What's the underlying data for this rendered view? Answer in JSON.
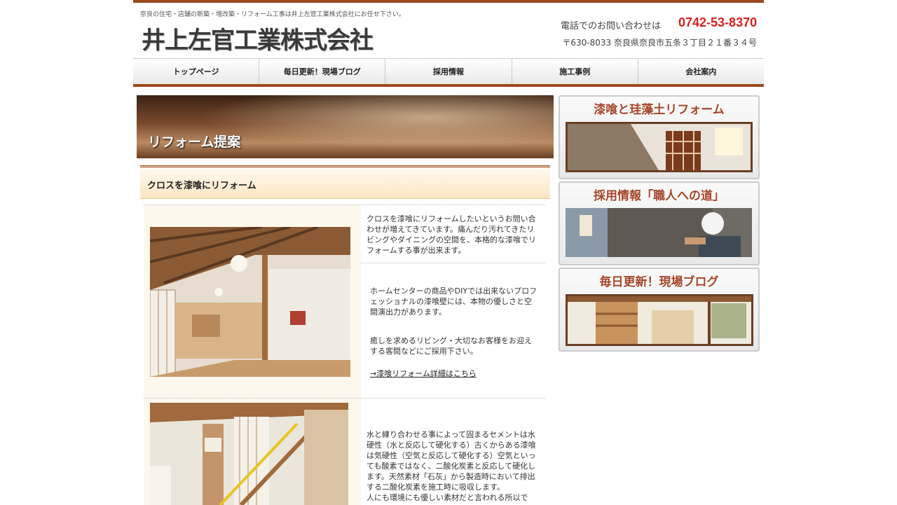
{
  "header": {
    "tagline": "奈良の住宅・店舗の新築・増改築・リフォーム工事は井上左官工業株式会社にお任せ下さい。",
    "logo": "井上左官工業株式会社",
    "contact_label": "電話でのお問い合わせは",
    "phone": "0742-53-8370",
    "address": "〒630-8033 奈良県奈良市五条３丁目２１番３４号"
  },
  "nav": {
    "items": [
      {
        "label": "トップページ"
      },
      {
        "label": "毎日更新！現場ブログ"
      },
      {
        "label": "採用情報"
      },
      {
        "label": "施工事例"
      },
      {
        "label": "会社案内"
      }
    ]
  },
  "hero": {
    "title": "リフォーム提案"
  },
  "section": {
    "title": "クロスを漆喰にリフォーム"
  },
  "content": {
    "para1": "クロスを漆喰にリフォームしたいというお問い合わせが増えてきています。痛んだり汚れてきたリビングやダイニングの空間を、本格的な漆喰でリフォームする事が出来ます。",
    "para2": "ホームセンターの商品やDIYでは出来ないプロフェッショナルの漆喰壁には、本物の優しさと空間演出力があります。",
    "para3": "癒しを求めるリビング・大切なお客様をお迎えする客間などにご採用下さい。",
    "link": "→漆喰リフォーム詳細はこちら",
    "para4": "水と練り合わせる事によって固まるセメントは水硬性（水と反応して硬化する）古くからある漆喰は気硬性（空気と反応して硬化する）空気といっても酸素ではなく、二酸化炭素と反応して硬化します。天然素材「石灰」から製造時において排出する二酸化炭素を施工時に吸収します。",
    "para5": "人にも環境にも優しい素材だと言われる所以で"
  },
  "sidebar": {
    "banners": [
      {
        "title": "漆喰と珪藻土リフォーム"
      },
      {
        "title": "採用情報「職人への道」"
      },
      {
        "title": "毎日更新！現場ブログ"
      }
    ]
  },
  "colors": {
    "accent": "#9b4a1e",
    "phone": "#d8201f",
    "banner_title": "#a4452a"
  }
}
